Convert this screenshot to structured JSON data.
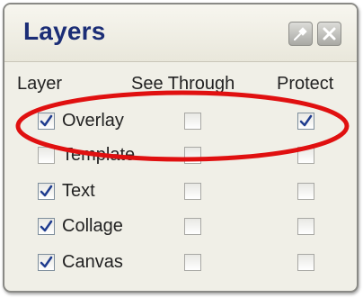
{
  "panel": {
    "title": "Layers",
    "buttons": {
      "pin": "pin-icon",
      "close": "close-icon"
    }
  },
  "columns": {
    "layer": "Layer",
    "see_through": "See Through",
    "protect": "Protect"
  },
  "layers": [
    {
      "name": "Overlay",
      "visible": true,
      "see_through": false,
      "protect": true
    },
    {
      "name": "Template",
      "visible": false,
      "see_through": false,
      "protect": false
    },
    {
      "name": "Text",
      "visible": true,
      "see_through": false,
      "protect": false
    },
    {
      "name": "Collage",
      "visible": true,
      "see_through": false,
      "protect": false
    },
    {
      "name": "Canvas",
      "visible": true,
      "see_through": false,
      "protect": false
    }
  ],
  "colors": {
    "title": "#1b2d76",
    "check": "#1f3c8f",
    "highlight_ellipse": "#e01010"
  }
}
